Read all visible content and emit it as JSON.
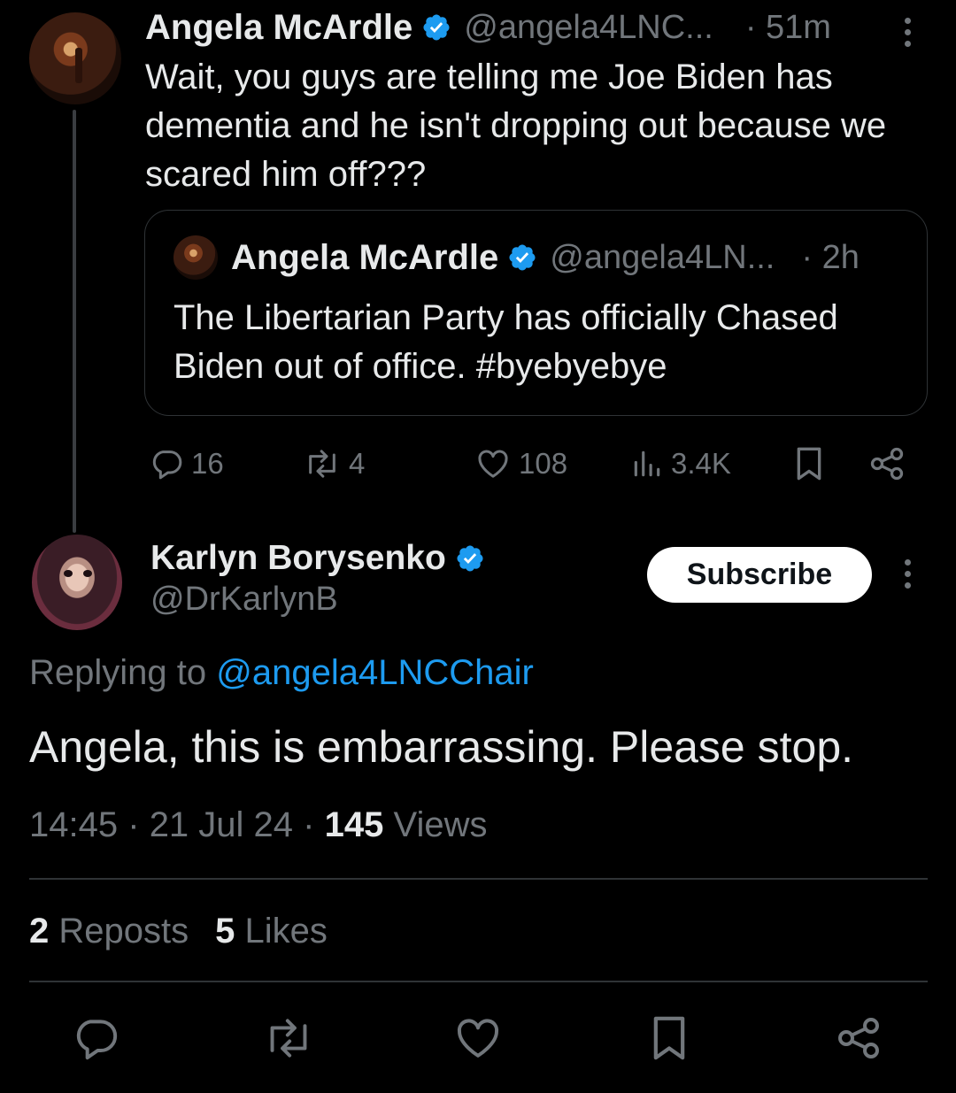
{
  "parent_tweet": {
    "author_name": "Angela McArdle",
    "handle": "@angela4LNC...",
    "time": "· 51m",
    "text": "Wait, you guys are telling me Joe Biden has dementia and he isn't dropping out because we scared him off???",
    "quote": {
      "author_name": "Angela McArdle",
      "handle": "@angela4LN...",
      "time": "· 2h",
      "text": "The Libertarian Party has officially Chased Biden out of office. #byebyebye"
    },
    "actions": {
      "replies": "16",
      "reposts": "4",
      "likes": "108",
      "views": "3.4K"
    }
  },
  "reply_tweet": {
    "author_name": "Karlyn Borysenko",
    "handle": "@DrKarlynB",
    "subscribe_label": "Subscribe",
    "replying_to_prefix": "Replying to",
    "replying_to_handle": "@angela4LNCChair",
    "text": "Angela, this is embarrassing. Please stop.",
    "time": "14:45",
    "date": "21 Jul 24",
    "views_count": "145",
    "views_label": "Views",
    "reposts_count": "2",
    "reposts_label": "Reposts",
    "likes_count": "5",
    "likes_label": "Likes"
  },
  "colors": {
    "background": "#000000",
    "primary_text": "#e7e9ea",
    "secondary_text": "#71767b",
    "accent_blue": "#1d9bf0",
    "divider": "#2f3336"
  },
  "icons": [
    "verified-badge-icon",
    "more-options-icon",
    "reply-icon",
    "repost-icon",
    "like-icon",
    "views-icon",
    "bookmark-icon",
    "share-icon"
  ]
}
